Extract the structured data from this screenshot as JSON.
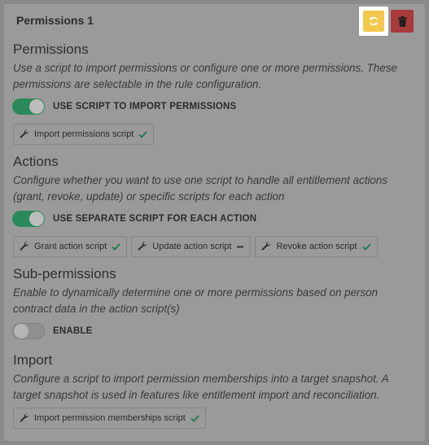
{
  "header": {
    "title": "Permissions 1"
  },
  "permissions": {
    "title": "Permissions",
    "description": "Use a script to import permissions or configure one or more permissions. These permissions are selectable in the rule configuration.",
    "toggle_label": "USE SCRIPT TO IMPORT PERMISSIONS",
    "toggle_on": true,
    "chips": [
      {
        "label": "Import permissions script",
        "status": "check"
      }
    ]
  },
  "actions": {
    "title": "Actions",
    "description": "Configure whether you want to use one script to handle all entitlement actions (grant, revoke, update) or specific scripts for each action",
    "toggle_label": "USE SEPARATE SCRIPT FOR EACH ACTION",
    "toggle_on": true,
    "chips": [
      {
        "label": "Grant action script",
        "status": "check"
      },
      {
        "label": "Update action script",
        "status": "dash"
      },
      {
        "label": "Revoke action script",
        "status": "check"
      }
    ]
  },
  "subpermissions": {
    "title": "Sub-permissions",
    "description": "Enable to dynamically determine one or more permissions based on person contract data in the action script(s)",
    "toggle_label": "ENABLE",
    "toggle_on": false
  },
  "import": {
    "title": "Import",
    "description": "Configure a script to import permission memberships into a target snapshot. A target snapshot is used in features like entitlement import and reconciliation.",
    "chips": [
      {
        "label": "Import permission memberships script",
        "status": "check"
      }
    ]
  },
  "colors": {
    "accent_green": "#2b8a5c",
    "refresh_yellow": "#f2c94c",
    "delete_red": "#a83a3a"
  },
  "icons": {
    "refresh": "refresh-icon",
    "delete": "trash-icon",
    "script": "wrench-icon",
    "ok": "check-icon",
    "pending": "dash-icon"
  }
}
